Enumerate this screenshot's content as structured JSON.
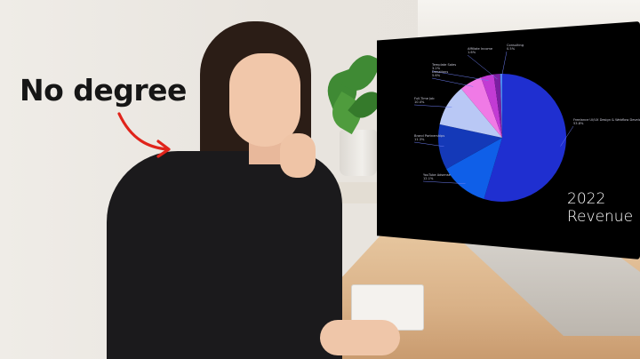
{
  "overlay": {
    "caption": "No degree"
  },
  "chart_data": {
    "type": "pie",
    "title": "2022 Revenue",
    "title_lines": [
      "2022",
      "Revenue"
    ],
    "slices": [
      {
        "label": "Freelance UI/UX Design & Webflow Development",
        "value": 53.8,
        "value_label": "53.8%",
        "color": "#1f2fd0"
      },
      {
        "label": "YouTube Adsense",
        "value": 12.1,
        "value_label": "12.1%",
        "color": "#0f5fe8"
      },
      {
        "label": "Brand Partnerships",
        "value": 11.3,
        "value_label": "11.3%",
        "color": "#1439b8"
      },
      {
        "label": "Full-Time Job",
        "value": 10.4,
        "value_label": "10.4%",
        "color": "#b9c8f5"
      },
      {
        "label": "Donations",
        "value": 5.6,
        "value_label": "5.6%",
        "color": "#f07ae6"
      },
      {
        "label": "Template Sales",
        "value": 3.2,
        "value_label": "3.2%",
        "color": "#c23bd4"
      },
      {
        "label": "Affiliate Income",
        "value": 1.6,
        "value_label": "1.6%",
        "color": "#7b1fa2"
      },
      {
        "label": "Consulting",
        "value": 0.5,
        "value_label": "0.5%",
        "color": "#4a8bf0"
      }
    ]
  }
}
